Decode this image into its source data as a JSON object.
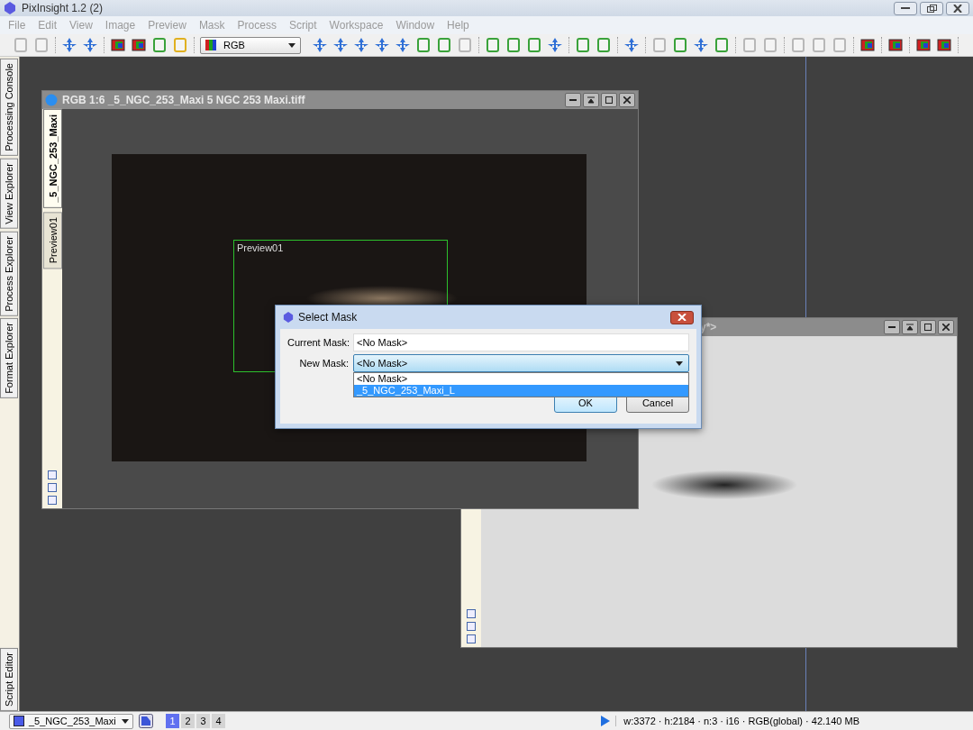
{
  "app": {
    "title": "PixInsight 1.2 (2)"
  },
  "menu": [
    "File",
    "Edit",
    "View",
    "Image",
    "Preview",
    "Mask",
    "Process",
    "Script",
    "Workspace",
    "Window",
    "Help"
  ],
  "toolbar": {
    "color_mode": "RGB"
  },
  "side_tabs": [
    {
      "label": "Processing Console"
    },
    {
      "label": "View Explorer"
    },
    {
      "label": "Process Explorer"
    },
    {
      "label": "Format Explorer"
    }
  ],
  "bottom_side_tab": {
    "label": "Script Editor"
  },
  "image_windows": [
    {
      "title": "RGB 1:6 _5_NGC_253_Maxi 5 NGC 253 Maxi.tiff",
      "view_tabs": [
        {
          "label": "_5_NGC_253_Maxi",
          "selected": true
        },
        {
          "label": "Preview01",
          "selected": false
        }
      ],
      "preview": {
        "label": "Preview01"
      }
    },
    {
      "title": "y*>"
    }
  ],
  "dialog": {
    "title": "Select Mask",
    "current_mask": {
      "label": "Current Mask:",
      "value": "<No Mask>"
    },
    "new_mask": {
      "label": "New Mask:",
      "value": "<No Mask>",
      "options": [
        {
          "label": "<No Mask>",
          "highlighted": false
        },
        {
          "label": "_5_NGC_253_Maxi_L",
          "highlighted": true
        }
      ]
    },
    "buttons": [
      {
        "label": "OK",
        "default": true
      },
      {
        "label": "Cancel",
        "default": false
      }
    ]
  },
  "status_bar": {
    "view": "_5_NGC_253_Maxi",
    "workspaces": [
      {
        "label": "1",
        "selected": true
      },
      {
        "label": "2",
        "selected": false
      },
      {
        "label": "3",
        "selected": false
      },
      {
        "label": "4",
        "selected": false
      }
    ],
    "info": "w:3372 · h:2184 · n:3 · i16 · RGB(global) · 42.140 MB"
  }
}
